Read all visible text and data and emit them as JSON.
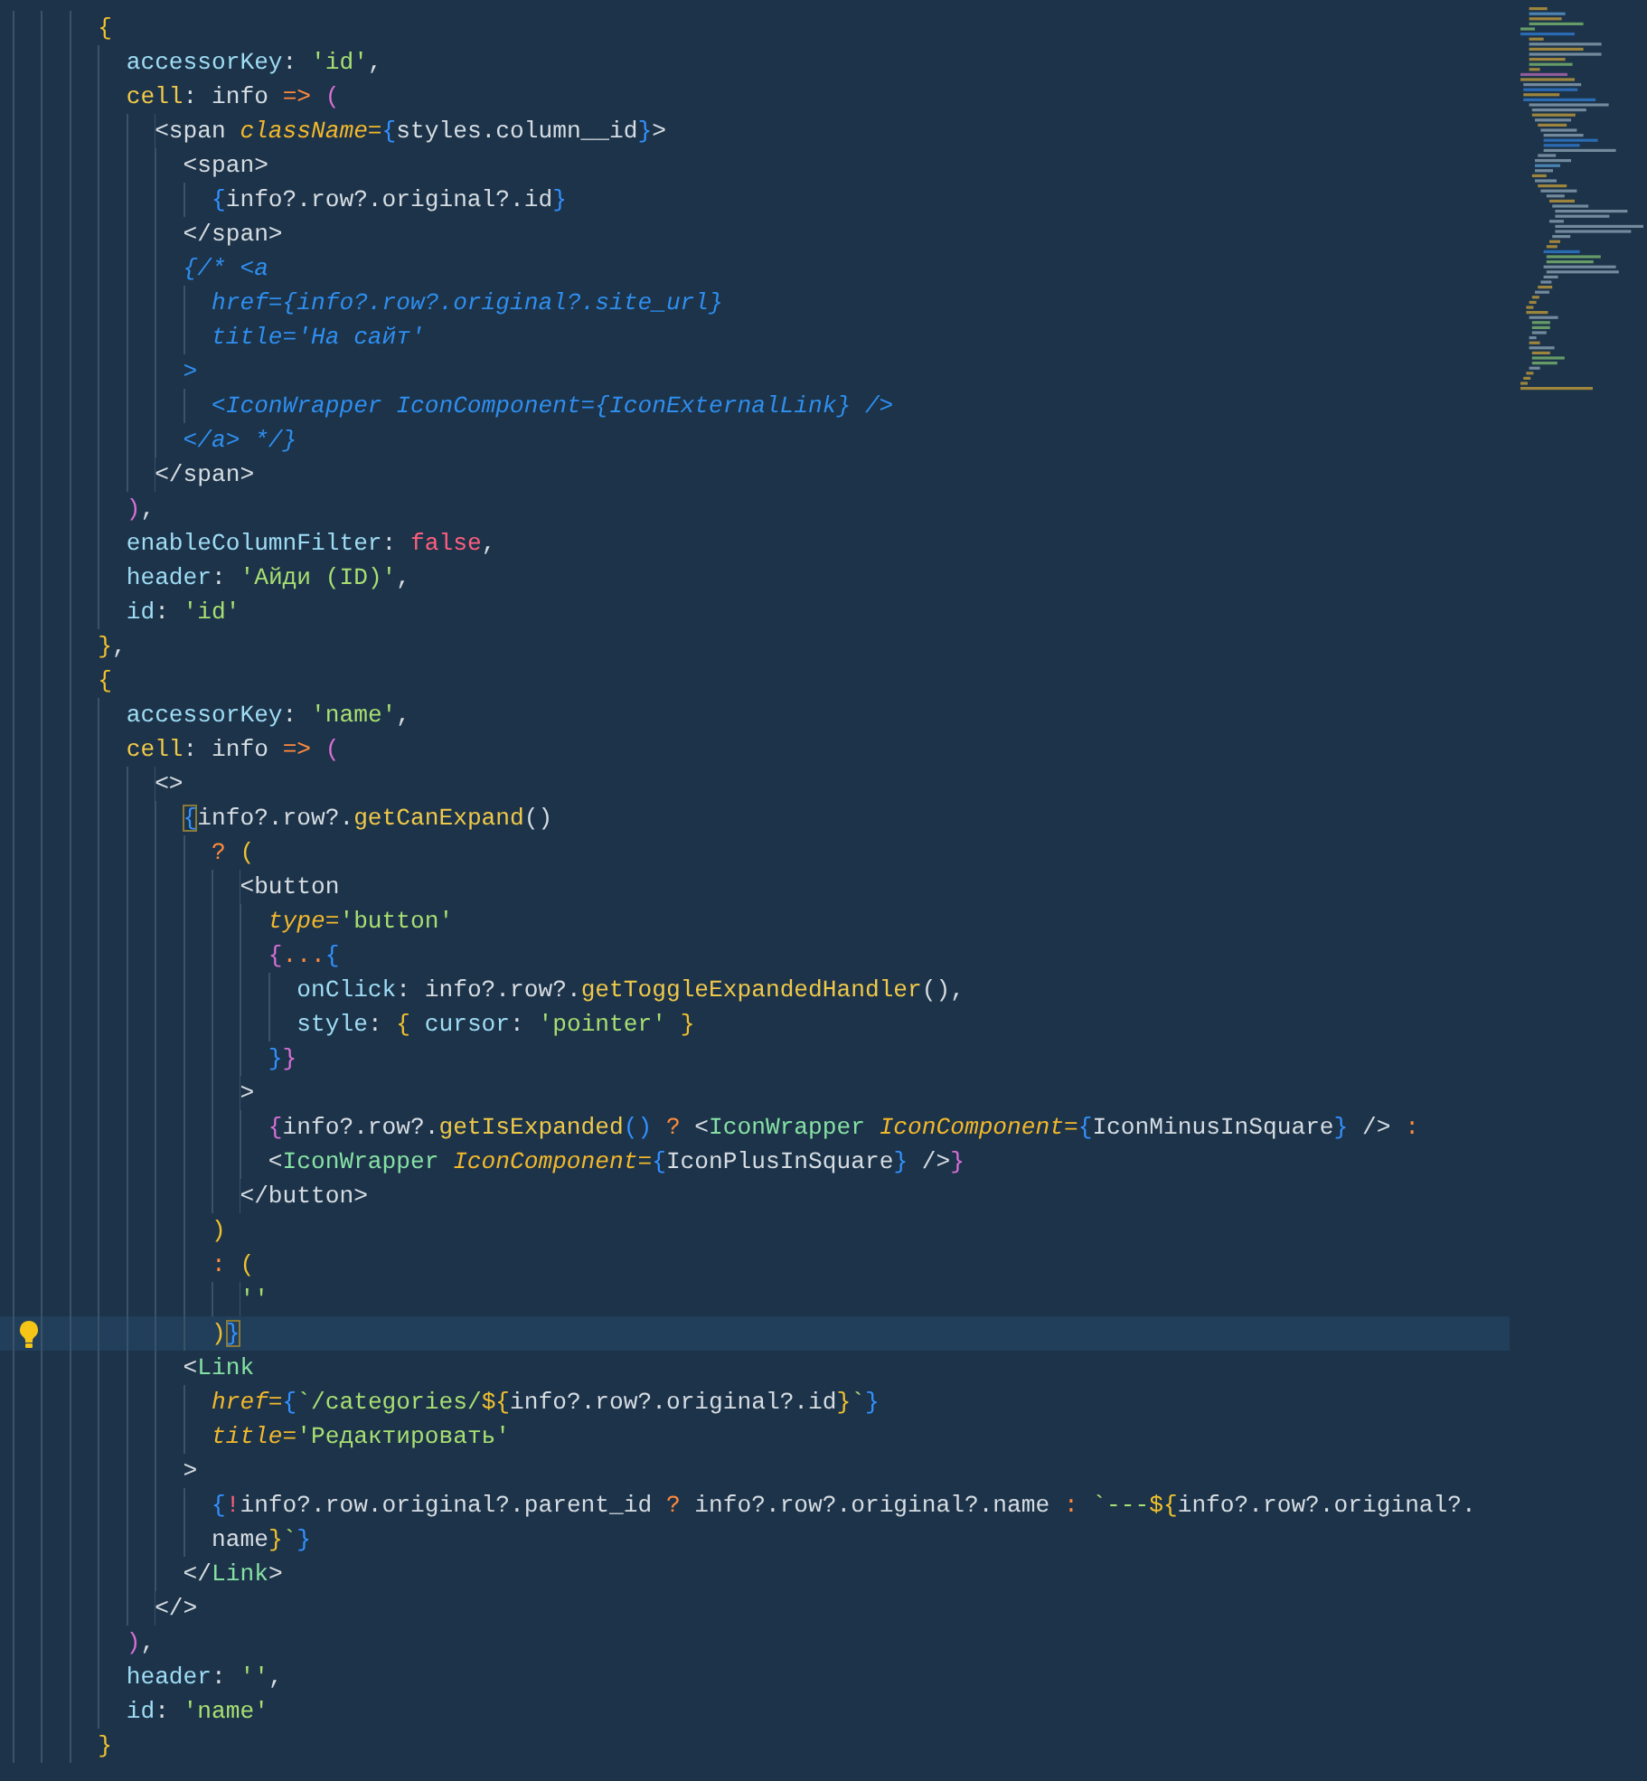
{
  "editor": {
    "lines": [
      {
        "current": false,
        "tokens": [
          {
            "text": "      {",
            "kind": "b1"
          }
        ]
      },
      {
        "current": false,
        "tokens": [
          {
            "text": "        accessorKey",
            "kind": "key"
          },
          {
            "text": ": ",
            "kind": "p"
          },
          {
            "text": "'id'",
            "kind": "str"
          },
          {
            "text": ",",
            "kind": "p"
          }
        ]
      },
      {
        "current": false,
        "tokens": [
          {
            "text": "        cell",
            "kind": "fn"
          },
          {
            "text": ": info ",
            "kind": "p"
          },
          {
            "text": "=>",
            "kind": "op"
          },
          {
            "text": " (",
            "kind": "b2"
          }
        ]
      },
      {
        "current": false,
        "tokens": [
          {
            "text": "          <span ",
            "kind": "p"
          },
          {
            "text": "className=",
            "kind": "attr"
          },
          {
            "text": "{",
            "kind": "b3"
          },
          {
            "text": "styles.column__id",
            "kind": "p"
          },
          {
            "text": "}",
            "kind": "b3"
          },
          {
            "text": ">",
            "kind": "p"
          }
        ]
      },
      {
        "current": false,
        "tokens": [
          {
            "text": "            <span>",
            "kind": "p"
          }
        ]
      },
      {
        "current": false,
        "tokens": [
          {
            "text": "              {",
            "kind": "b3"
          },
          {
            "text": "info?.row?.original?.id",
            "kind": "p"
          },
          {
            "text": "}",
            "kind": "b3"
          }
        ]
      },
      {
        "current": false,
        "tokens": [
          {
            "text": "            </span>",
            "kind": "p"
          }
        ]
      },
      {
        "current": false,
        "tokens": [
          {
            "text": "            {/* <a",
            "kind": "comment"
          }
        ]
      },
      {
        "current": false,
        "tokens": [
          {
            "text": "              href={info?.row?.original?.site_url}",
            "kind": "comment"
          }
        ]
      },
      {
        "current": false,
        "tokens": [
          {
            "text": "              title='На сайт'",
            "kind": "comment"
          }
        ]
      },
      {
        "current": false,
        "tokens": [
          {
            "text": "            >",
            "kind": "comment"
          }
        ]
      },
      {
        "current": false,
        "tokens": [
          {
            "text": "              <IconWrapper IconComponent={IconExternalLink} />",
            "kind": "comment"
          }
        ]
      },
      {
        "current": false,
        "tokens": [
          {
            "text": "            </a> */}",
            "kind": "comment"
          }
        ]
      },
      {
        "current": false,
        "tokens": [
          {
            "text": "          </span>",
            "kind": "p"
          }
        ]
      },
      {
        "current": false,
        "tokens": [
          {
            "text": "        )",
            "kind": "b2"
          },
          {
            "text": ",",
            "kind": "p"
          }
        ]
      },
      {
        "current": false,
        "tokens": [
          {
            "text": "        enableColumnFilter",
            "kind": "key"
          },
          {
            "text": ": ",
            "kind": "p"
          },
          {
            "text": "false",
            "kind": "bool"
          },
          {
            "text": ",",
            "kind": "p"
          }
        ]
      },
      {
        "current": false,
        "tokens": [
          {
            "text": "        header",
            "kind": "key"
          },
          {
            "text": ": ",
            "kind": "p"
          },
          {
            "text": "'Айди (ID)'",
            "kind": "str"
          },
          {
            "text": ",",
            "kind": "p"
          }
        ]
      },
      {
        "current": false,
        "tokens": [
          {
            "text": "        id",
            "kind": "key"
          },
          {
            "text": ": ",
            "kind": "p"
          },
          {
            "text": "'id'",
            "kind": "str"
          }
        ]
      },
      {
        "current": false,
        "tokens": [
          {
            "text": "      }",
            "kind": "b1"
          },
          {
            "text": ",",
            "kind": "p"
          }
        ]
      },
      {
        "current": false,
        "tokens": [
          {
            "text": "      {",
            "kind": "b1"
          }
        ]
      },
      {
        "current": false,
        "tokens": [
          {
            "text": "        accessorKey",
            "kind": "key"
          },
          {
            "text": ": ",
            "kind": "p"
          },
          {
            "text": "'name'",
            "kind": "str"
          },
          {
            "text": ",",
            "kind": "p"
          }
        ]
      },
      {
        "current": false,
        "tokens": [
          {
            "text": "        cell",
            "kind": "fn"
          },
          {
            "text": ": info ",
            "kind": "p"
          },
          {
            "text": "=>",
            "kind": "op"
          },
          {
            "text": " (",
            "kind": "b2"
          }
        ]
      },
      {
        "current": false,
        "tokens": [
          {
            "text": "          <>",
            "kind": "p"
          }
        ]
      },
      {
        "current": false,
        "tokens": [
          {
            "text": "            {",
            "kind": "b3",
            "matched": true
          },
          {
            "text": "info?.row?.",
            "kind": "p"
          },
          {
            "text": "getCanExpand",
            "kind": "fn"
          },
          {
            "text": "()",
            "kind": "p"
          }
        ]
      },
      {
        "current": false,
        "tokens": [
          {
            "text": "              ?",
            "kind": "op"
          },
          {
            "text": " (",
            "kind": "b1"
          }
        ]
      },
      {
        "current": false,
        "tokens": [
          {
            "text": "                <button",
            "kind": "p"
          }
        ]
      },
      {
        "current": false,
        "tokens": [
          {
            "text": "                  type=",
            "kind": "attr"
          },
          {
            "text": "'button'",
            "kind": "str"
          }
        ]
      },
      {
        "current": false,
        "tokens": [
          {
            "text": "                  {",
            "kind": "b2"
          },
          {
            "text": "...",
            "kind": "op"
          },
          {
            "text": "{",
            "kind": "b3"
          }
        ]
      },
      {
        "current": false,
        "tokens": [
          {
            "text": "                    onClick",
            "kind": "key"
          },
          {
            "text": ": info?.row?.",
            "kind": "p"
          },
          {
            "text": "getToggleExpandedHandler",
            "kind": "fn"
          },
          {
            "text": "(),",
            "kind": "p"
          }
        ]
      },
      {
        "current": false,
        "tokens": [
          {
            "text": "                    style",
            "kind": "key"
          },
          {
            "text": ": ",
            "kind": "p"
          },
          {
            "text": "{",
            "kind": "b1"
          },
          {
            "text": " cursor",
            "kind": "key"
          },
          {
            "text": ": ",
            "kind": "p"
          },
          {
            "text": "'pointer'",
            "kind": "str"
          },
          {
            "text": " }",
            "kind": "b1"
          }
        ]
      },
      {
        "current": false,
        "tokens": [
          {
            "text": "                  }",
            "kind": "b3"
          },
          {
            "text": "}",
            "kind": "b2"
          }
        ]
      },
      {
        "current": false,
        "tokens": [
          {
            "text": "                >",
            "kind": "p"
          }
        ]
      },
      {
        "current": false,
        "tokens": [
          {
            "text": "                  {",
            "kind": "b2"
          },
          {
            "text": "info?.row?.",
            "kind": "p"
          },
          {
            "text": "getIsExpanded",
            "kind": "fn"
          },
          {
            "text": "()",
            "kind": "b3"
          },
          {
            "text": " ?",
            "kind": "op"
          },
          {
            "text": " <",
            "kind": "p"
          },
          {
            "text": "IconWrapper",
            "kind": "comp"
          },
          {
            "text": " IconComponent=",
            "kind": "attr"
          },
          {
            "text": "{",
            "kind": "b3"
          },
          {
            "text": "IconMinusInSquare",
            "kind": "p"
          },
          {
            "text": "}",
            "kind": "b3"
          },
          {
            "text": " />",
            "kind": "p"
          },
          {
            "text": " :",
            "kind": "op"
          }
        ]
      },
      {
        "current": false,
        "tokens": [
          {
            "text": "                  <",
            "kind": "p"
          },
          {
            "text": "IconWrapper",
            "kind": "comp"
          },
          {
            "text": " IconComponent=",
            "kind": "attr"
          },
          {
            "text": "{",
            "kind": "b3"
          },
          {
            "text": "IconPlusInSquare",
            "kind": "p"
          },
          {
            "text": "}",
            "kind": "b3"
          },
          {
            "text": " />",
            "kind": "p"
          },
          {
            "text": "}",
            "kind": "b2"
          }
        ]
      },
      {
        "current": false,
        "tokens": [
          {
            "text": "                </button>",
            "kind": "p"
          }
        ]
      },
      {
        "current": false,
        "tokens": [
          {
            "text": "              )",
            "kind": "b1"
          }
        ]
      },
      {
        "current": false,
        "tokens": [
          {
            "text": "              :",
            "kind": "op"
          },
          {
            "text": " (",
            "kind": "b1"
          }
        ]
      },
      {
        "current": false,
        "tokens": [
          {
            "text": "                ''",
            "kind": "str"
          }
        ]
      },
      {
        "current": true,
        "tokens": [
          {
            "text": "              )",
            "kind": "b1"
          },
          {
            "text": "}",
            "kind": "b3",
            "matched": true
          }
        ]
      },
      {
        "current": false,
        "tokens": [
          {
            "text": "            <",
            "kind": "p"
          },
          {
            "text": "Link",
            "kind": "comp"
          }
        ]
      },
      {
        "current": false,
        "tokens": [
          {
            "text": "              href=",
            "kind": "attr"
          },
          {
            "text": "{",
            "kind": "b3"
          },
          {
            "text": "`/categories/",
            "kind": "str"
          },
          {
            "text": "${",
            "kind": "b1"
          },
          {
            "text": "info?.row?.original?.id",
            "kind": "p"
          },
          {
            "text": "}",
            "kind": "b1"
          },
          {
            "text": "`",
            "kind": "str"
          },
          {
            "text": "}",
            "kind": "b3"
          }
        ]
      },
      {
        "current": false,
        "tokens": [
          {
            "text": "              title=",
            "kind": "attr"
          },
          {
            "text": "'Редактировать'",
            "kind": "str"
          }
        ]
      },
      {
        "current": false,
        "tokens": [
          {
            "text": "            >",
            "kind": "p"
          }
        ]
      },
      {
        "current": false,
        "tokens": [
          {
            "text": "              {",
            "kind": "b3"
          },
          {
            "text": "!",
            "kind": "bool"
          },
          {
            "text": "info?.row.original?.parent_id ",
            "kind": "p"
          },
          {
            "text": "?",
            "kind": "op"
          },
          {
            "text": " info?.row?.original?.name ",
            "kind": "p"
          },
          {
            "text": ":",
            "kind": "op"
          },
          {
            "text": " `---",
            "kind": "str"
          },
          {
            "text": "${",
            "kind": "b1"
          },
          {
            "text": "info?.row?.original?.",
            "kind": "p"
          }
        ]
      },
      {
        "current": false,
        "tokens": [
          {
            "text": "              name",
            "kind": "p"
          },
          {
            "text": "}",
            "kind": "b1"
          },
          {
            "text": "`",
            "kind": "str"
          },
          {
            "text": "}",
            "kind": "b3"
          }
        ]
      },
      {
        "current": false,
        "tokens": [
          {
            "text": "            </",
            "kind": "p"
          },
          {
            "text": "Link",
            "kind": "comp"
          },
          {
            "text": ">",
            "kind": "p"
          }
        ]
      },
      {
        "current": false,
        "tokens": [
          {
            "text": "          </>",
            "kind": "p"
          }
        ]
      },
      {
        "current": false,
        "tokens": [
          {
            "text": "        )",
            "kind": "b2"
          },
          {
            "text": ",",
            "kind": "p"
          }
        ]
      },
      {
        "current": false,
        "tokens": [
          {
            "text": "        header",
            "kind": "key"
          },
          {
            "text": ": ",
            "kind": "p"
          },
          {
            "text": "''",
            "kind": "str"
          },
          {
            "text": ",",
            "kind": "p"
          }
        ]
      },
      {
        "current": false,
        "tokens": [
          {
            "text": "        id",
            "kind": "key"
          },
          {
            "text": ": ",
            "kind": "p"
          },
          {
            "text": "'name'",
            "kind": "str"
          }
        ]
      },
      {
        "current": false,
        "tokens": [
          {
            "text": "      }",
            "kind": "b1"
          }
        ]
      }
    ]
  }
}
